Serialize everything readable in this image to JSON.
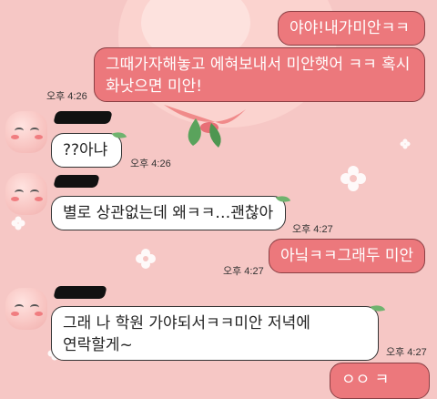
{
  "messages": [
    {
      "id": "m1",
      "side": "out",
      "lines": [
        "야야!내가미안ㅋㅋ"
      ]
    },
    {
      "id": "m2",
      "side": "out",
      "lines": [
        "그때가자해놓고 에혀보내서 미안햇어 ㅋㅋ 혹시",
        "화낫으면 미안!"
      ]
    },
    {
      "id": "m3",
      "side": "in",
      "lines": [
        "??아냐"
      ]
    },
    {
      "id": "m4",
      "side": "in",
      "lines": [
        "별로 상관없는데 왜ㅋㅋ…괜찮아"
      ]
    },
    {
      "id": "m5",
      "side": "out",
      "lines": [
        "아닠ㅋㅋ그래두 미안"
      ]
    },
    {
      "id": "m6",
      "side": "in",
      "lines": [
        "그래 나 학원 가야되서ㅋㅋ미안 저녁에",
        "연락할게~"
      ]
    },
    {
      "id": "m7",
      "side": "out",
      "lines": [
        "ㅇㅇ ㅋ"
      ]
    }
  ],
  "times": {
    "t_m2": "오후 4:26",
    "t_m3": "오후 4:26",
    "t_m4": "오후 4:27",
    "t_m5": "오후 4:27",
    "t_m6": "오후 4:27"
  },
  "colors": {
    "background": "#f6c7c5",
    "outgoing_bubble": "#ec787c",
    "incoming_bubble": "#ffffff",
    "leaf": "#6fb36e"
  },
  "icons": [
    "peach-character-wallpaper",
    "flower-icon",
    "leaf-icon",
    "profile-avatar"
  ]
}
